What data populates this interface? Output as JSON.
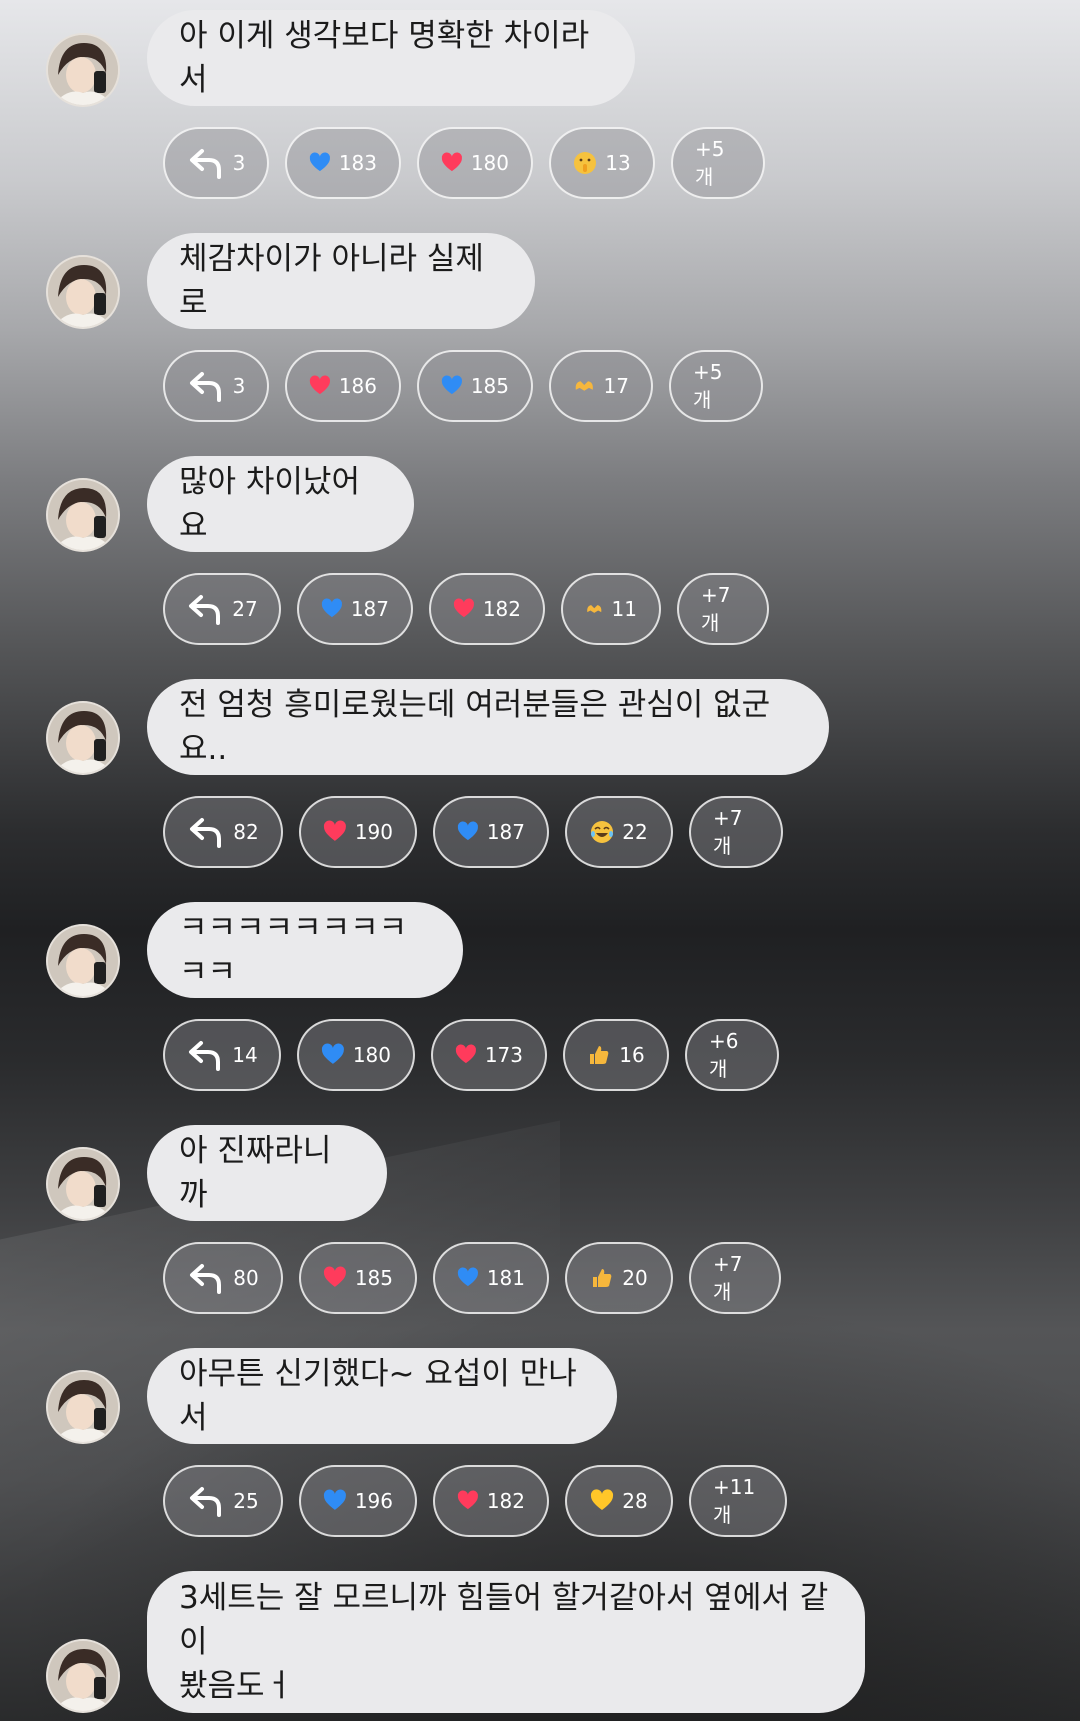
{
  "messages": [
    {
      "text": "아 이게 생각보다 명확한 차이라서",
      "reactions": [
        {
          "type": "reply",
          "icon": "reply-arrow-icon",
          "count": "3"
        },
        {
          "type": "emoji",
          "icon": "blue-heart-icon",
          "color": "#2f8cf5",
          "count": "183"
        },
        {
          "type": "emoji",
          "icon": "red-heart-icon",
          "color": "#ff3b5c",
          "count": "180"
        },
        {
          "type": "emoji",
          "icon": "shushing-face-icon",
          "color": "#f6c23e",
          "count": "13"
        },
        {
          "type": "more",
          "label": "+5개"
        }
      ]
    },
    {
      "text": "체감차이가 아니라 실제로",
      "reactions": [
        {
          "type": "reply",
          "icon": "reply-arrow-icon",
          "count": "3"
        },
        {
          "type": "emoji",
          "icon": "red-heart-icon",
          "color": "#ff3b5c",
          "count": "186"
        },
        {
          "type": "emoji",
          "icon": "blue-heart-icon",
          "color": "#2f8cf5",
          "count": "185"
        },
        {
          "type": "emoji",
          "icon": "heart-hands-icon",
          "color": "#f6b73c",
          "count": "17"
        },
        {
          "type": "more",
          "label": "+5개"
        }
      ]
    },
    {
      "text": "많아 차이났어요",
      "reactions": [
        {
          "type": "reply",
          "icon": "reply-arrow-icon",
          "count": "27"
        },
        {
          "type": "emoji",
          "icon": "blue-heart-icon",
          "color": "#2f8cf5",
          "count": "187"
        },
        {
          "type": "emoji",
          "icon": "red-heart-icon",
          "color": "#ff3b5c",
          "count": "182"
        },
        {
          "type": "emoji",
          "icon": "heart-hands-icon",
          "color": "#f6b73c",
          "count": "11"
        },
        {
          "type": "more",
          "label": "+7개"
        }
      ]
    },
    {
      "text": "전 엄청 흥미로웠는데 여러분들은 관심이 없군요..",
      "reactions": [
        {
          "type": "reply",
          "icon": "reply-arrow-icon",
          "count": "82"
        },
        {
          "type": "emoji",
          "icon": "red-heart-icon",
          "color": "#ff3b5c",
          "count": "190"
        },
        {
          "type": "emoji",
          "icon": "blue-heart-icon",
          "color": "#2f8cf5",
          "count": "187"
        },
        {
          "type": "emoji",
          "icon": "tears-of-joy-icon",
          "color": "#f6c23e",
          "count": "22"
        },
        {
          "type": "more",
          "label": "+7개"
        }
      ]
    },
    {
      "text": "ㅋㅋㅋㅋㅋㅋㅋㅋㅋㅋ",
      "reactions": [
        {
          "type": "reply",
          "icon": "reply-arrow-icon",
          "count": "14"
        },
        {
          "type": "emoji",
          "icon": "blue-heart-icon",
          "color": "#2f8cf5",
          "count": "180"
        },
        {
          "type": "emoji",
          "icon": "red-heart-icon",
          "color": "#ff3b5c",
          "count": "173"
        },
        {
          "type": "emoji",
          "icon": "thumbs-up-icon",
          "color": "#f6b73c",
          "count": "16"
        },
        {
          "type": "more",
          "label": "+6개"
        }
      ]
    },
    {
      "text": "아 진짜라니까",
      "reactions": [
        {
          "type": "reply",
          "icon": "reply-arrow-icon",
          "count": "80"
        },
        {
          "type": "emoji",
          "icon": "red-heart-icon",
          "color": "#ff3b5c",
          "count": "185"
        },
        {
          "type": "emoji",
          "icon": "blue-heart-icon",
          "color": "#2f8cf5",
          "count": "181"
        },
        {
          "type": "emoji",
          "icon": "thumbs-up-icon",
          "color": "#f6b73c",
          "count": "20"
        },
        {
          "type": "more",
          "label": "+7개"
        }
      ]
    },
    {
      "text": "아무튼 신기했다~ 요섭이 만나서",
      "reactions": [
        {
          "type": "reply",
          "icon": "reply-arrow-icon",
          "count": "25"
        },
        {
          "type": "emoji",
          "icon": "blue-heart-icon",
          "color": "#2f8cf5",
          "count": "196"
        },
        {
          "type": "emoji",
          "icon": "red-heart-icon",
          "color": "#ff3b5c",
          "count": "182"
        },
        {
          "type": "emoji",
          "icon": "yellow-heart-icon",
          "color": "#ffc629",
          "count": "28"
        },
        {
          "type": "more",
          "label": "+11개"
        }
      ]
    },
    {
      "text": "3세트는 잘 모르니까 힘들어 할거같아서 옆에서 같이\n봤음도ㅓ",
      "reactions": []
    }
  ]
}
